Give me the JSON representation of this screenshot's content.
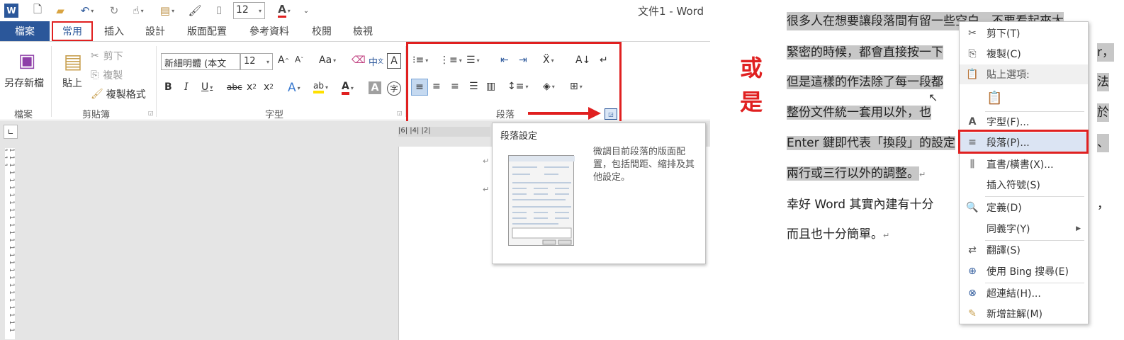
{
  "word": {
    "logo": "W",
    "window_title": "文件1 - Word",
    "qat_font_size": "12",
    "tabs": [
      {
        "label": "檔案"
      },
      {
        "label": "常用"
      },
      {
        "label": "插入"
      },
      {
        "label": "設計"
      },
      {
        "label": "版面配置"
      },
      {
        "label": "參考資料"
      },
      {
        "label": "校閱"
      },
      {
        "label": "檢視"
      }
    ],
    "ribbon": {
      "save_new_label": "另存新檔",
      "group_file": "檔案",
      "paste_label": "貼上",
      "cut_label": "剪下",
      "copy_label": "複製",
      "format_painter_label": "複製格式",
      "group_clipboard": "剪貼簿",
      "font_name": "新細明體 (本文",
      "font_size": "12",
      "group_font": "字型",
      "group_paragraph": "段落"
    },
    "ruler_h": "|6| |4| |2| ",
    "tooltip": {
      "title": "段落設定",
      "description": "微調目前段落的版面配置，包括間距、縮排及其他設定。"
    }
  },
  "or_text": "或是",
  "doc_right": {
    "lines": [
      "很多人在想要讓段落間有留一些空白，不要看起來太",
      "緊密的時候，都會直接按一下",
      "但是這樣的作法除了每一段都",
      "整份文件統一套用以外，也",
      "Enter 鍵即代表「換段」的設定",
      "兩行或三行以外的調整。",
      "幸好 Word 其實內建有十分",
      "而且也十分簡單。"
    ],
    "line_tails": [
      "",
      "r，",
      "法",
      "於",
      "、",
      "",
      "，",
      ""
    ]
  },
  "context_menu": {
    "items": [
      {
        "icon": "scissors-icon",
        "glyph": "✂",
        "label": "剪下(T)"
      },
      {
        "icon": "copy-icon",
        "glyph": "⎘",
        "label": "複製(C)"
      },
      {
        "icon": "paste-icon",
        "glyph": "📋",
        "label": "貼上選項:"
      },
      {
        "icon": "paste-keep-icon",
        "glyph": "📋",
        "label": ""
      },
      {
        "icon": "font-icon",
        "glyph": "A",
        "label": "字型(F)..."
      },
      {
        "icon": "paragraph-icon",
        "glyph": "≡",
        "label": "段落(P)..."
      },
      {
        "icon": "text-direction-icon",
        "glyph": "⫼",
        "label": "直書/橫書(X)..."
      },
      {
        "icon": "symbol-icon",
        "glyph": "",
        "label": "插入符號(S)"
      },
      {
        "icon": "define-icon",
        "glyph": "🔍",
        "label": "定義(D)"
      },
      {
        "icon": "synonym-icon",
        "glyph": "",
        "label": "同義字(Y)"
      },
      {
        "icon": "translate-icon",
        "glyph": "⇄",
        "label": "翻譯(S)"
      },
      {
        "icon": "bing-search-icon",
        "glyph": "⊕",
        "label": "使用 Bing 搜尋(E)"
      },
      {
        "icon": "hyperlink-icon",
        "glyph": "⊗",
        "label": "超連結(H)..."
      },
      {
        "icon": "comment-icon",
        "glyph": "✎",
        "label": "新增註解(M)"
      }
    ]
  }
}
